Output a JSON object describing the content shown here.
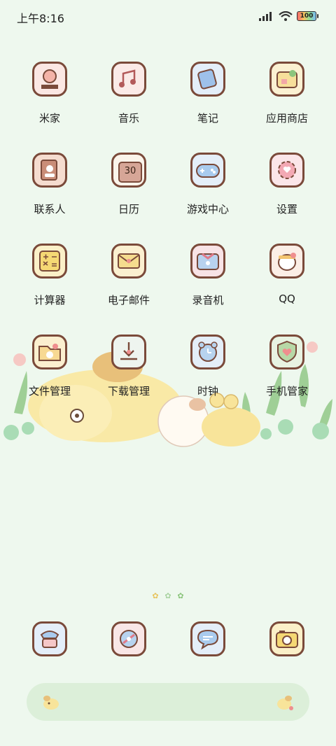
{
  "status_bar": {
    "time": "上午8:16",
    "battery": "100"
  },
  "apps": [
    {
      "label": "米家",
      "icon": "mijia-icon",
      "color": "#f6c9c0"
    },
    {
      "label": "音乐",
      "icon": "music-icon",
      "color": "#f8d9d4"
    },
    {
      "label": "笔记",
      "icon": "notes-icon",
      "color": "#c9ddf3"
    },
    {
      "label": "应用商店",
      "icon": "app-store-icon",
      "color": "#f7e3a6"
    },
    {
      "label": "联系人",
      "icon": "contacts-icon",
      "color": "#e9b9a3"
    },
    {
      "label": "日历",
      "icon": "calendar-icon",
      "color": "#d7a79a",
      "badge": "30"
    },
    {
      "label": "游戏中心",
      "icon": "game-center-icon",
      "color": "#c8dff2"
    },
    {
      "label": "设置",
      "icon": "gear-icon",
      "color": "#f6c5cc"
    },
    {
      "label": "计算器",
      "icon": "calculator-icon",
      "color": "#f7df8f"
    },
    {
      "label": "电子邮件",
      "icon": "email-icon",
      "color": "#f7e1a3"
    },
    {
      "label": "录音机",
      "icon": "recorder-icon",
      "color": "#f1c6cc"
    },
    {
      "label": "QQ",
      "icon": "qq-icon",
      "color": "#f5dfd2"
    },
    {
      "label": "文件管理",
      "icon": "folder-icon",
      "color": "#f8dba2"
    },
    {
      "label": "下载管理",
      "icon": "download-icon",
      "color": "#dfe8e0"
    },
    {
      "label": "时钟",
      "icon": "clock-icon",
      "color": "#c9ddf0"
    },
    {
      "label": "手机管家",
      "icon": "security-shield-icon",
      "color": "#c8dfbd"
    }
  ],
  "dock": [
    {
      "icon": "phone-icon",
      "color": "#c7dff3"
    },
    {
      "icon": "browser-icon",
      "color": "#f2c8c8"
    },
    {
      "icon": "messages-icon",
      "color": "#c6dcf2"
    },
    {
      "icon": "camera-icon",
      "color": "#f6d98a"
    }
  ],
  "page_indicator": {
    "pages": 3,
    "current": 1
  }
}
